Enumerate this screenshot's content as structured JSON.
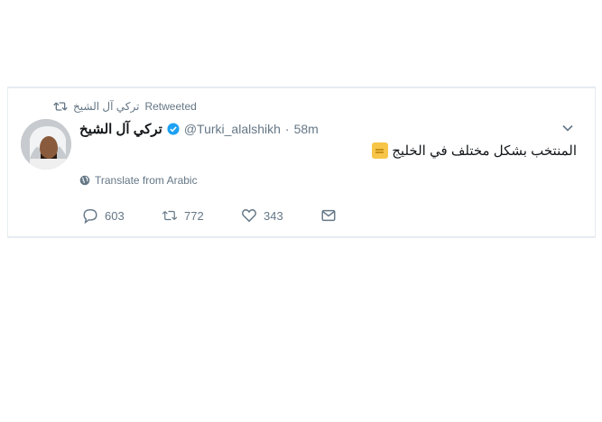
{
  "tweet": {
    "retweeted_by": "تركي آل الشيخ",
    "retweeted_label": "Retweeted",
    "display_name": "تركي آل الشيخ",
    "handle": "@Turki_alalshikh",
    "separator": "·",
    "time": "58m",
    "text": "المنتخب بشكل مختلف في الخليج",
    "emoji_icon": "thumbs-up-icon",
    "translate_label": "Translate from Arabic",
    "counts": {
      "replies": "603",
      "retweets": "772",
      "likes": "343"
    }
  },
  "colors": {
    "muted": "#657786",
    "verified": "#1da1f2",
    "border": "#e6ecf0"
  }
}
